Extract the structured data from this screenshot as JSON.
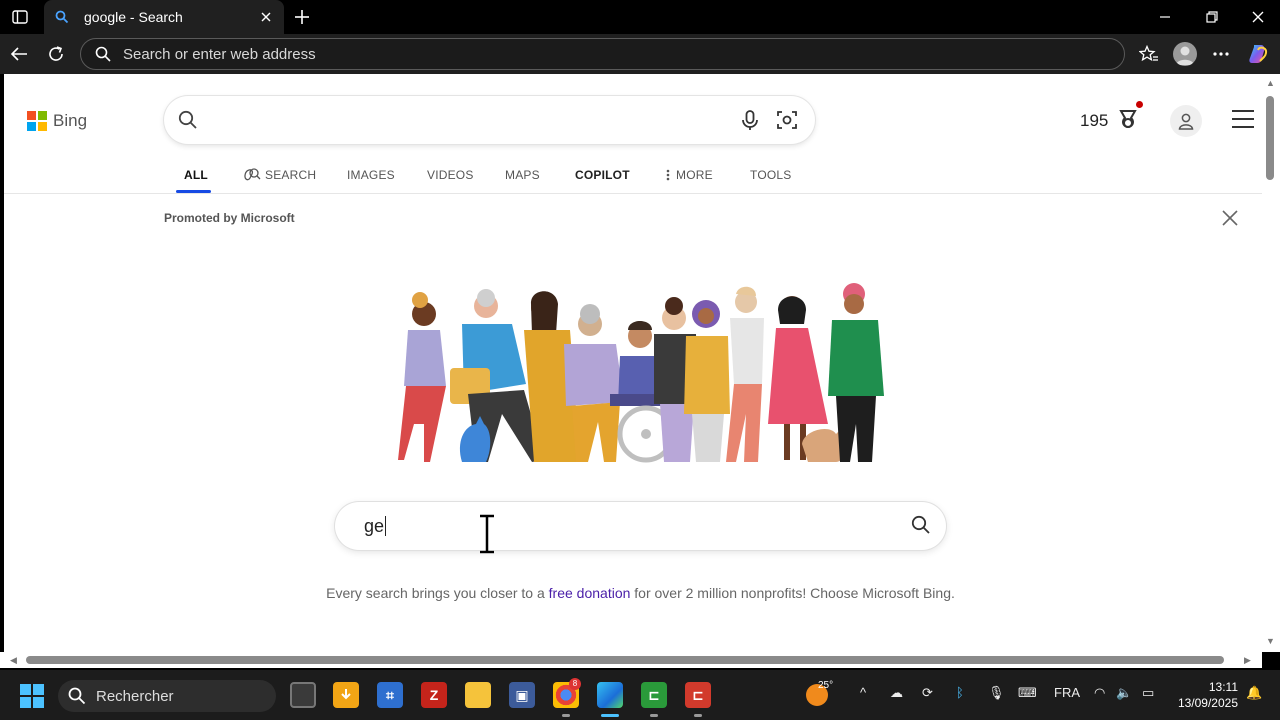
{
  "browser": {
    "tab_title": "google - Search",
    "address_placeholder": "Search or enter web address"
  },
  "bing": {
    "logo_text": "Bing",
    "reward_points": "195",
    "scopes": [
      "ALL",
      "SEARCH",
      "IMAGES",
      "VIDEOS",
      "MAPS",
      "COPILOT",
      "MORE",
      "TOOLS"
    ],
    "active_scope": "ALL",
    "promo_label": "Promoted by Microsoft",
    "search_query": "ge",
    "tagline_before": "Every search brings you closer to a ",
    "tagline_link": "free donation",
    "tagline_after": " for over 2 million nonprofits! Choose Microsoft Bing."
  },
  "taskbar": {
    "search_label": "Rechercher",
    "weather_temp": "25°",
    "chrome_badge": "8",
    "language": "FRA",
    "time": "13:11",
    "date": "13/09/2025"
  },
  "colors": {
    "accent": "#174ae4",
    "ms_red": "#f25022",
    "ms_green": "#7fba00",
    "ms_blue": "#00a4ef",
    "ms_yellow": "#ffb900"
  }
}
